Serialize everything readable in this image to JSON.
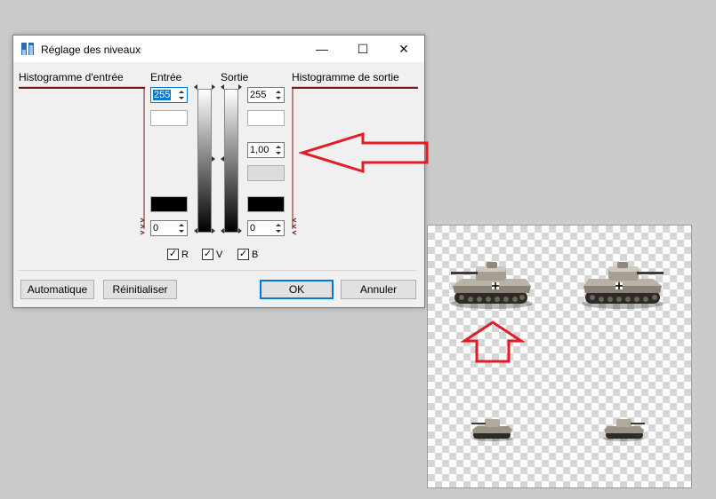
{
  "dialog": {
    "title": "Réglage des niveaux",
    "window_controls": {
      "minimize": "—",
      "maximize": "☐",
      "close": "✕"
    },
    "headers": {
      "input_histogram": "Histogramme d'entrée",
      "input": "Entrée",
      "output": "Sortie",
      "output_histogram": "Histogramme de sortie"
    },
    "input_high": "255",
    "input_low": "0",
    "output_high": "255",
    "output_gamma": "1,00",
    "output_low": "0",
    "channels": [
      {
        "label": "R",
        "checked": true
      },
      {
        "label": "V",
        "checked": true
      },
      {
        "label": "B",
        "checked": true
      }
    ],
    "buttons": {
      "auto": "Automatique",
      "reset": "Réinitialiser",
      "ok": "OK",
      "cancel": "Annuler"
    }
  },
  "colors": {
    "accent": "#0078d7",
    "annotation_red": "#e31b23",
    "histogram_line": "#7a1b1b"
  },
  "annotations": [
    "arrow-left",
    "arrow-up"
  ],
  "canvas": {
    "sprites": [
      "tank-large",
      "tank-large",
      "tank-small",
      "tank-small"
    ]
  }
}
